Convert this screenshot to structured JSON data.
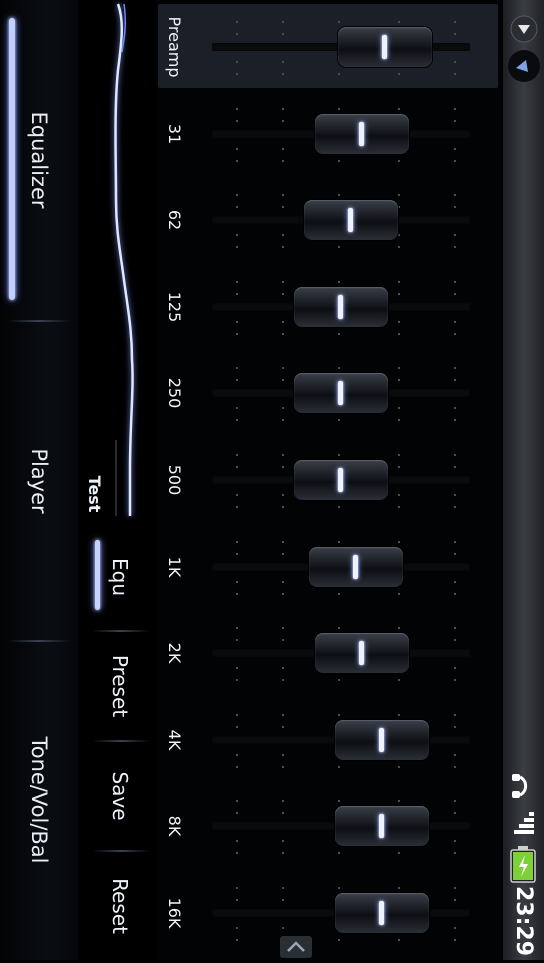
{
  "tabs": [
    {
      "label": "Equalizer",
      "active": true
    },
    {
      "label": "Player",
      "active": false
    },
    {
      "label": "Tone/Vol/Bal",
      "active": false
    }
  ],
  "curve_panel": {
    "test_label": "Test",
    "subtabs": [
      {
        "label": "Equ",
        "active": true
      },
      {
        "label": "Preset",
        "active": false
      },
      {
        "label": "Save",
        "active": false
      },
      {
        "label": "Reset",
        "active": false
      }
    ]
  },
  "bands": [
    {
      "label": "Preamp",
      "level": 0.67
    },
    {
      "label": "31",
      "level": 0.58
    },
    {
      "label": "62",
      "level": 0.54
    },
    {
      "label": "125",
      "level": 0.5
    },
    {
      "label": "250",
      "level": 0.5
    },
    {
      "label": "500",
      "level": 0.5
    },
    {
      "label": "1K",
      "level": 0.56
    },
    {
      "label": "2K",
      "level": 0.58
    },
    {
      "label": "4K",
      "level": 0.66
    },
    {
      "label": "8K",
      "level": 0.66
    },
    {
      "label": "16K",
      "level": 0.66
    }
  ],
  "status": {
    "time": "23:29",
    "icons": [
      "headphones-icon",
      "signal-icon",
      "battery-charging-icon"
    ],
    "battery_color": "#7ed03a"
  },
  "accent_color": "#a9baff"
}
